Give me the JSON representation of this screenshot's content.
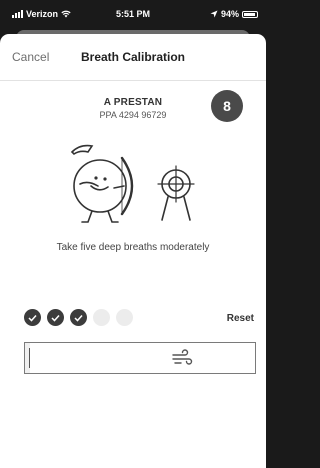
{
  "status": {
    "carrier": "Verizon",
    "time": "5:51 PM",
    "battery": "94%"
  },
  "nav": {
    "cancel": "Cancel",
    "title": "Breath Calibration"
  },
  "pilot": {
    "name": "A PRESTAN",
    "id": "PPA 4294 96729"
  },
  "breath_count": "8",
  "instruction": "Take five deep breaths moderately",
  "progress": {
    "completed": 3,
    "total": 5
  },
  "reset_label": "Reset",
  "breath_meter": {
    "level": 0.02
  },
  "icons": {
    "signal": "cellular-signal-icon",
    "wifi": "wifi-icon",
    "location": "location-arrow-icon",
    "battery": "battery-icon",
    "check": "checkmark-icon",
    "wind": "wind-icon",
    "illustration": "cartoon-archer-with-target-illustration"
  }
}
